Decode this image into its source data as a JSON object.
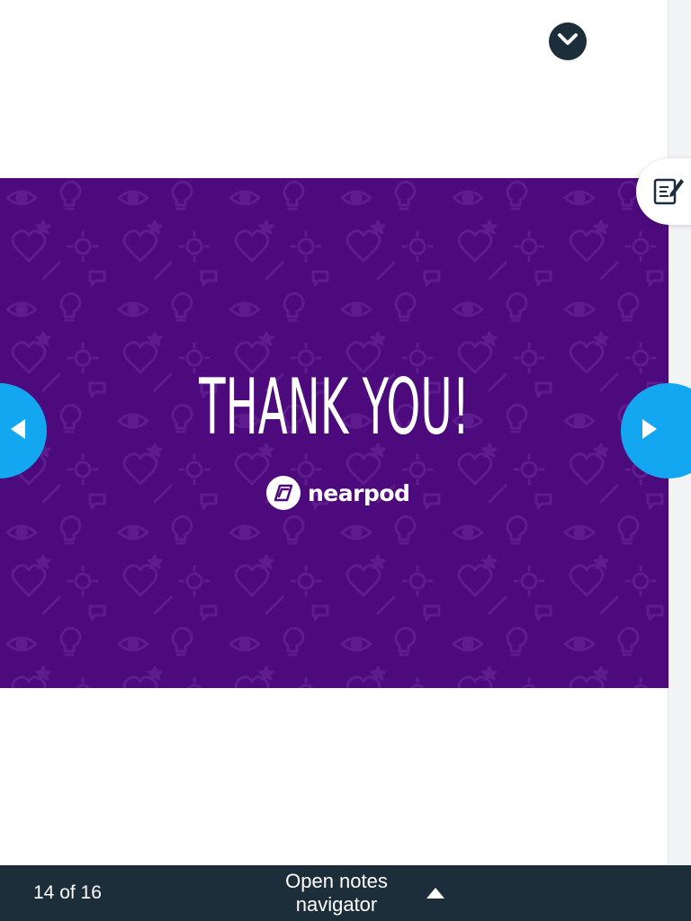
{
  "header": {
    "collapse_icon": "chevron-down-icon"
  },
  "side_tools": {
    "notes_icon": "edit-notes-icon"
  },
  "slide": {
    "title": "THANK YOU!",
    "brand_name": "nearpod",
    "background_color": "#4d0a7c",
    "pattern_icons": [
      "eye-icon",
      "lightbulb-icon",
      "heart-icon",
      "head-icon",
      "sun-icon",
      "high-five-icon",
      "pencil-icon",
      "speech-bubble-icon",
      "star-icon"
    ]
  },
  "navigation": {
    "prev_icon": "triangle-left-icon",
    "next_icon": "triangle-right-icon",
    "accent_color": "#12a7f0"
  },
  "footer": {
    "counter": "14 of 16",
    "notes_navigator_label": "Open notes navigator",
    "notes_navigator_icon": "caret-up-icon",
    "background_color": "#1c2e3a"
  }
}
